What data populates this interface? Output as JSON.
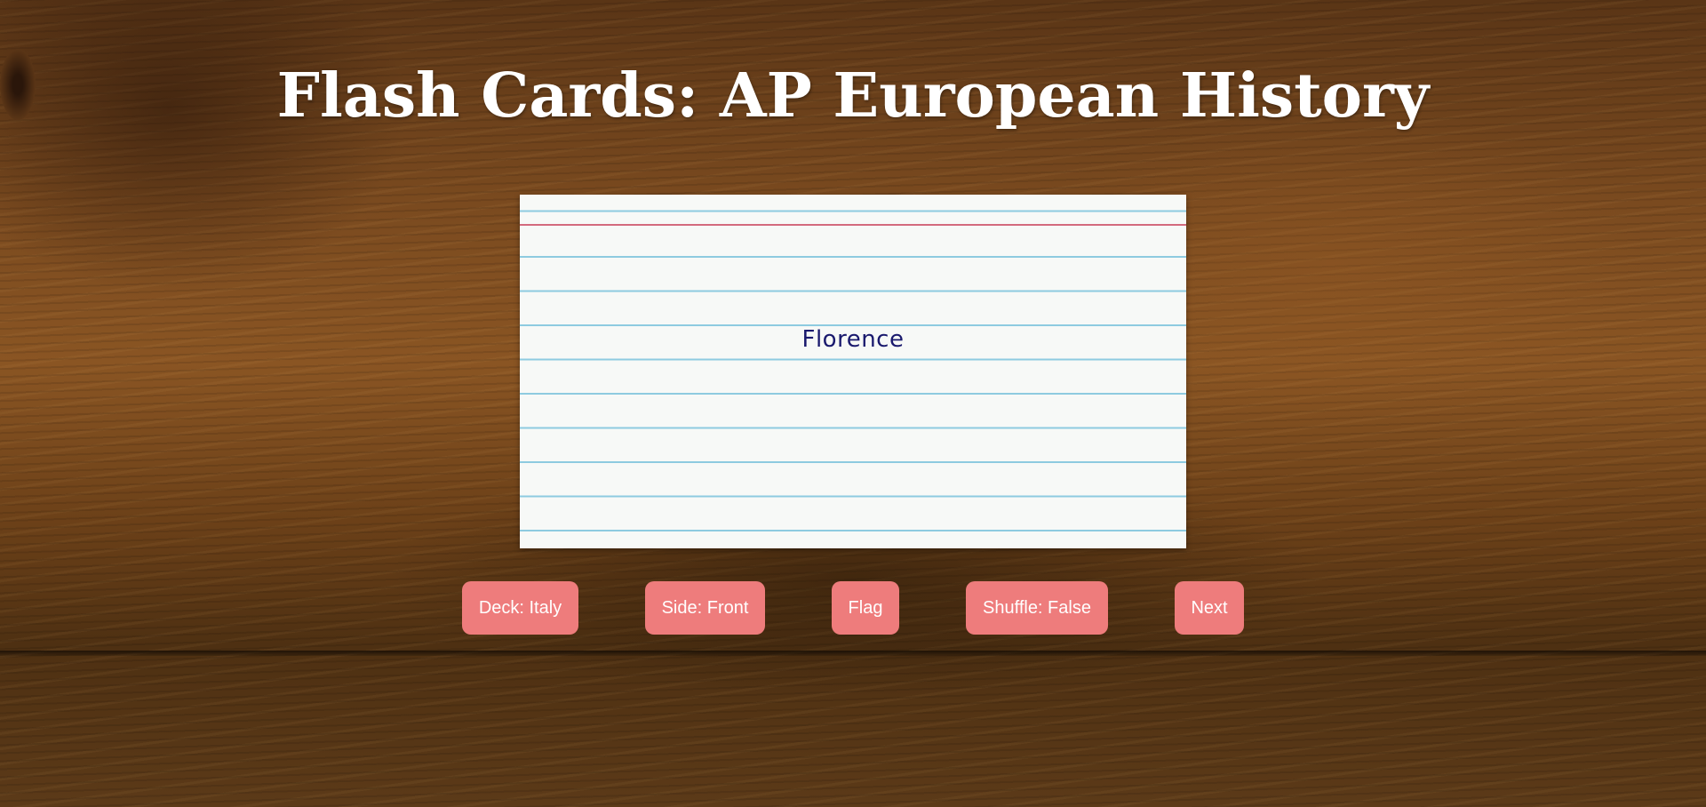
{
  "page": {
    "title": "Flash Cards: AP European History"
  },
  "card": {
    "text": "Florence"
  },
  "controls": {
    "deck_label": "Deck: Italy",
    "side_label": "Side: Front",
    "flag_label": "Flag",
    "shuffle_label": "Shuffle: False",
    "next_label": "Next"
  },
  "colors": {
    "button_bg": "#ee7c7c",
    "button_text": "#ffffff",
    "title_text": "#ffffff",
    "card_text": "#1a1a6e",
    "card_red_line": "#d36a7e",
    "card_blue_line": "#8ecbe0"
  }
}
